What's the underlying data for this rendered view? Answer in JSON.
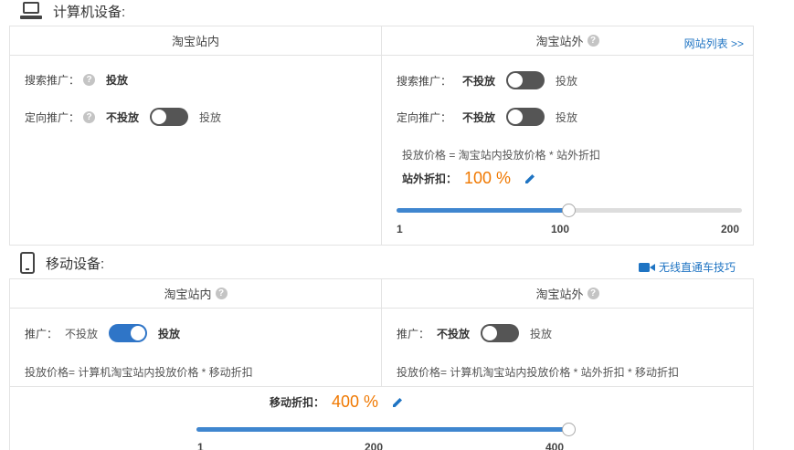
{
  "pc": {
    "title": "计算机设备:",
    "inside": {
      "header": "淘宝站内",
      "search_label": "搜索推广：",
      "search_value": "投放",
      "target_label": "定向推广：",
      "off": "不投放",
      "on": "投放",
      "target_toggle_on": false
    },
    "outside": {
      "header": "淘宝站外",
      "site_list_link": "网站列表 >>",
      "search_label": "搜索推广：",
      "target_label": "定向推广：",
      "off": "不投放",
      "on": "投放",
      "search_toggle_on": false,
      "target_toggle_on": false,
      "formula": "投放价格 = 淘宝站内投放价格 * 站外折扣",
      "discount_label": "站外折扣：",
      "discount_value": "100 %",
      "slider": {
        "min": 1,
        "mid": 100,
        "max": 200,
        "value": 100,
        "min_label": "1",
        "mid_label": "100",
        "max_label": "200"
      }
    }
  },
  "mobile": {
    "title": "移动设备:",
    "tips_link": "无线直通车技巧",
    "inside": {
      "header": "淘宝站内",
      "promo_label": "推广：",
      "off": "不投放",
      "on": "投放",
      "toggle_on": true,
      "formula": "投放价格= 计算机淘宝站内投放价格 * 移动折扣"
    },
    "outside": {
      "header": "淘宝站外",
      "promo_label": "推广：",
      "off": "不投放",
      "on": "投放",
      "toggle_on": false,
      "formula": "投放价格= 计算机淘宝站内投放价格 * 站外折扣 * 移动折扣"
    },
    "discount_label": "移动折扣：",
    "discount_value": "400 %",
    "slider": {
      "min": 1,
      "mid": 200,
      "max": 400,
      "value": 400,
      "min_label": "1",
      "mid_label": "200",
      "max_label": "400"
    }
  },
  "colors": {
    "accent": "#2f75c7",
    "orange": "#f07800",
    "toggle_off": "#555555"
  }
}
